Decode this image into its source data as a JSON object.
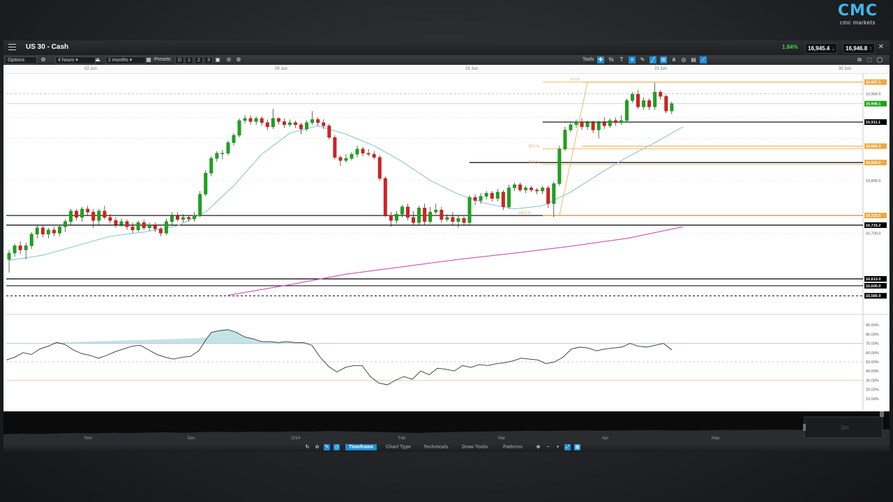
{
  "brand": {
    "mark": "CMC",
    "name": "cmc markets"
  },
  "titlebar": {
    "instrument": "US 30 - Cash",
    "change": "1.84%",
    "sell_price": "16,945.4",
    "buy_price": "16,946.8",
    "close_glyph": "✕"
  },
  "toolbar": {
    "options": "Options",
    "interval": "4 hours",
    "range": "2 months",
    "presets": "Presets",
    "preset_buttons": [
      "D",
      "1",
      "2",
      "3"
    ],
    "tools": "Tools"
  },
  "date_axis": {
    "labels": [
      "02 Jun",
      "09 Jun",
      "16 Jun",
      "23 Jun",
      "30 Jun"
    ]
  },
  "price_labels": [
    "16,987.1",
    "16,964.9",
    "16,946.1",
    "16,911.1",
    "16,865.3",
    "16,834.2",
    "16,800.0",
    "16,733.5",
    "16,715.2",
    "16,700.0",
    "16,613.0",
    "16,600.0",
    "16,580.9"
  ],
  "fib_labels": [
    "0.0 %",
    "50.0 %",
    "61.8 %",
    "100.0 %"
  ],
  "rsi_labels": [
    "90.00%",
    "80.00%",
    "70.00%",
    "60.00%",
    "50.00%",
    "40.00%",
    "30.00%",
    "20.00%",
    "10.00%"
  ],
  "navigator": {
    "months": [
      "Nov",
      "Dec",
      "2014",
      "Feb",
      "Mar",
      "Apr",
      "May"
    ],
    "window_label": "2m"
  },
  "bottom_tabs": [
    "Timeframe",
    "Chart Type",
    "Technicals",
    "Draw Tools",
    "Patterns"
  ],
  "colors": {
    "up": "#1aa51a",
    "down": "#d62020",
    "accent": "#1d8ed6",
    "sma_short": "#8cc6d8",
    "sma_long": "#d04fb0",
    "fib": "#f0a840",
    "last_price_bg": "#1aa51a"
  },
  "chart_data": {
    "type": "candlestick",
    "ylim": [
      16560,
      17000
    ],
    "candles": [
      [
        16650,
        16662,
        16625,
        16668
      ],
      [
        16662,
        16676,
        16655,
        16680
      ],
      [
        16676,
        16668,
        16660,
        16684
      ],
      [
        16668,
        16676,
        16650,
        16682
      ],
      [
        16676,
        16698,
        16670,
        16702
      ],
      [
        16698,
        16710,
        16690,
        16716
      ],
      [
        16710,
        16698,
        16692,
        16714
      ],
      [
        16698,
        16706,
        16690,
        16710
      ],
      [
        16706,
        16700,
        16694,
        16712
      ],
      [
        16700,
        16712,
        16694,
        16716
      ],
      [
        16712,
        16722,
        16702,
        16726
      ],
      [
        16722,
        16742,
        16716,
        16746
      ],
      [
        16742,
        16730,
        16724,
        16746
      ],
      [
        16730,
        16746,
        16722,
        16750
      ],
      [
        16746,
        16740,
        16734,
        16752
      ],
      [
        16740,
        16724,
        16710,
        16746
      ],
      [
        16724,
        16742,
        16716,
        16746
      ],
      [
        16742,
        16730,
        16726,
        16752
      ],
      [
        16730,
        16724,
        16718,
        16736
      ],
      [
        16724,
        16716,
        16710,
        16730
      ],
      [
        16716,
        16722,
        16712,
        16728
      ],
      [
        16722,
        16712,
        16706,
        16726
      ],
      [
        16712,
        16706,
        16700,
        16720
      ],
      [
        16706,
        16720,
        16702,
        16724
      ],
      [
        16720,
        16710,
        16706,
        16726
      ],
      [
        16710,
        16716,
        16704,
        16720
      ],
      [
        16716,
        16708,
        16702,
        16720
      ],
      [
        16708,
        16700,
        16694,
        16712
      ],
      [
        16700,
        16722,
        16696,
        16728
      ],
      [
        16722,
        16733,
        16716,
        16740
      ],
      [
        16733,
        16726,
        16722,
        16740
      ],
      [
        16726,
        16730,
        16720,
        16736
      ],
      [
        16730,
        16727,
        16722,
        16734
      ],
      [
        16727,
        16734,
        16722,
        16740
      ],
      [
        16734,
        16774,
        16730,
        16780
      ],
      [
        16774,
        16814,
        16770,
        16820
      ],
      [
        16814,
        16842,
        16808,
        16846
      ],
      [
        16842,
        16852,
        16836,
        16856
      ],
      [
        16852,
        16852,
        16840,
        16858
      ],
      [
        16852,
        16872,
        16848,
        16876
      ],
      [
        16872,
        16886,
        16866,
        16890
      ],
      [
        16886,
        16914,
        16882,
        16918
      ],
      [
        16914,
        16918,
        16908,
        16924
      ],
      [
        16918,
        16912,
        16906,
        16924
      ],
      [
        16912,
        16918,
        16906,
        16922
      ],
      [
        16918,
        16910,
        16904,
        16922
      ],
      [
        16910,
        16902,
        16896,
        16916
      ],
      [
        16902,
        16918,
        16898,
        16936
      ],
      [
        16918,
        16912,
        16906,
        16920
      ],
      [
        16912,
        16906,
        16900,
        16918
      ],
      [
        16906,
        16910,
        16902,
        16916
      ],
      [
        16910,
        16906,
        16900,
        16914
      ],
      [
        16906,
        16898,
        16888,
        16910
      ],
      [
        16898,
        16910,
        16894,
        16914
      ],
      [
        16910,
        16916,
        16906,
        16932
      ],
      [
        16916,
        16910,
        16904,
        16920
      ],
      [
        16910,
        16904,
        16898,
        16916
      ],
      [
        16904,
        16882,
        16878,
        16908
      ],
      [
        16882,
        16844,
        16840,
        16886
      ],
      [
        16844,
        16838,
        16828,
        16848
      ],
      [
        16838,
        16842,
        16834,
        16850
      ],
      [
        16842,
        16850,
        16838,
        16854
      ],
      [
        16850,
        16860,
        16844,
        16866
      ],
      [
        16860,
        16852,
        16846,
        16864
      ],
      [
        16852,
        16850,
        16846,
        16860
      ],
      [
        16850,
        16844,
        16840,
        16856
      ],
      [
        16844,
        16804,
        16800,
        16848
      ],
      [
        16804,
        16734,
        16730,
        16808
      ],
      [
        16734,
        16724,
        16712,
        16740
      ],
      [
        16724,
        16736,
        16718,
        16742
      ],
      [
        16736,
        16750,
        16730,
        16754
      ],
      [
        16750,
        16730,
        16724,
        16756
      ],
      [
        16730,
        16720,
        16716,
        16742
      ],
      [
        16720,
        16748,
        16716,
        16752
      ],
      [
        16748,
        16722,
        16716,
        16756
      ],
      [
        16722,
        16740,
        16718,
        16750
      ],
      [
        16740,
        16744,
        16736,
        16756
      ],
      [
        16744,
        16726,
        16720,
        16750
      ],
      [
        16726,
        16730,
        16722,
        16736
      ],
      [
        16730,
        16722,
        16716,
        16740
      ],
      [
        16722,
        16728,
        16710,
        16734
      ],
      [
        16728,
        16720,
        16714,
        16732
      ],
      [
        16720,
        16768,
        16716,
        16772
      ],
      [
        16768,
        16762,
        16754,
        16774
      ],
      [
        16762,
        16770,
        16756,
        16776
      ],
      [
        16770,
        16776,
        16764,
        16780
      ],
      [
        16776,
        16766,
        16760,
        16780
      ],
      [
        16766,
        16778,
        16760,
        16784
      ],
      [
        16778,
        16750,
        16744,
        16782
      ],
      [
        16750,
        16786,
        16746,
        16792
      ],
      [
        16786,
        16792,
        16780,
        16796
      ],
      [
        16792,
        16782,
        16778,
        16796
      ],
      [
        16782,
        16786,
        16776,
        16790
      ],
      [
        16786,
        16782,
        16778,
        16790
      ],
      [
        16782,
        16780,
        16774,
        16786
      ],
      [
        16780,
        16786,
        16774,
        16790
      ],
      [
        16786,
        16756,
        16748,
        16790
      ],
      [
        16756,
        16794,
        16730,
        16798
      ],
      [
        16794,
        16860,
        16790,
        16866
      ],
      [
        16860,
        16896,
        16856,
        16902
      ],
      [
        16896,
        16906,
        16892,
        16910
      ],
      [
        16906,
        16912,
        16900,
        16916
      ],
      [
        16912,
        16902,
        16896,
        16918
      ],
      [
        16902,
        16910,
        16896,
        16914
      ],
      [
        16910,
        16896,
        16890,
        16914
      ],
      [
        16896,
        16910,
        16880,
        16914
      ],
      [
        16910,
        16904,
        16898,
        16920
      ],
      [
        16904,
        16914,
        16900,
        16918
      ],
      [
        16914,
        16910,
        16904,
        16920
      ],
      [
        16910,
        16914,
        16906,
        16924
      ],
      [
        16914,
        16952,
        16910,
        16956
      ],
      [
        16952,
        16964,
        16948,
        16968
      ],
      [
        16964,
        16940,
        16936,
        16972
      ],
      [
        16940,
        16952,
        16934,
        16958
      ],
      [
        16952,
        16940,
        16934,
        16956
      ],
      [
        16940,
        16968,
        16934,
        16986
      ],
      [
        16968,
        16960,
        16954,
        16972
      ],
      [
        16960,
        16932,
        16928,
        16964
      ],
      [
        16932,
        16946,
        16926,
        16950
      ]
    ],
    "sma_short": [
      [
        0,
        16648
      ],
      [
        6,
        16658
      ],
      [
        12,
        16676
      ],
      [
        18,
        16694
      ],
      [
        24,
        16702
      ],
      [
        30,
        16714
      ],
      [
        35,
        16740
      ],
      [
        40,
        16790
      ],
      [
        45,
        16850
      ],
      [
        50,
        16890
      ],
      [
        55,
        16904
      ],
      [
        60,
        16888
      ],
      [
        65,
        16866
      ],
      [
        70,
        16836
      ],
      [
        75,
        16800
      ],
      [
        80,
        16774
      ],
      [
        85,
        16756
      ],
      [
        90,
        16746
      ],
      [
        95,
        16752
      ],
      [
        100,
        16778
      ],
      [
        105,
        16812
      ],
      [
        110,
        16844
      ],
      [
        115,
        16872
      ],
      [
        120,
        16902
      ]
    ],
    "sma_long": [
      [
        39,
        16582
      ],
      [
        50,
        16602
      ],
      [
        60,
        16622
      ],
      [
        70,
        16636
      ],
      [
        80,
        16650
      ],
      [
        90,
        16662
      ],
      [
        100,
        16675
      ],
      [
        110,
        16690
      ],
      [
        120,
        16712
      ]
    ],
    "horizontal_levels": [
      16987.1,
      16964.9,
      16946.1,
      16911.1,
      16865.3,
      16834.2,
      16733.5,
      16715.2,
      16613.0,
      16600.0,
      16580.9
    ],
    "fibonacci": {
      "high": 16987.1,
      "low": 16733.5,
      "levels": [
        "0.0 %",
        "50.0 %",
        "61.8 %",
        "100.0 %"
      ]
    },
    "rsi": {
      "ylim": [
        0,
        100
      ],
      "overbought": 70,
      "oversold": 30,
      "values": [
        [
          0,
          52
        ],
        [
          4,
          55
        ],
        [
          8,
          60
        ],
        [
          12,
          58
        ],
        [
          16,
          64
        ],
        [
          20,
          67
        ],
        [
          24,
          71
        ],
        [
          28,
          69
        ],
        [
          32,
          63
        ],
        [
          36,
          59
        ],
        [
          40,
          57
        ],
        [
          44,
          54
        ],
        [
          48,
          57
        ],
        [
          52,
          61
        ],
        [
          56,
          64
        ],
        [
          60,
          67
        ],
        [
          64,
          68
        ],
        [
          68,
          63
        ],
        [
          72,
          58
        ],
        [
          76,
          55
        ],
        [
          80,
          53
        ],
        [
          84,
          55
        ],
        [
          88,
          56
        ],
        [
          92,
          62
        ],
        [
          96,
          76
        ],
        [
          98,
          82
        ],
        [
          102,
          84
        ],
        [
          106,
          85
        ],
        [
          110,
          82
        ],
        [
          114,
          77
        ],
        [
          118,
          75
        ],
        [
          122,
          72
        ],
        [
          126,
          72
        ],
        [
          130,
          71
        ],
        [
          134,
          72
        ],
        [
          138,
          71
        ],
        [
          142,
          71
        ],
        [
          146,
          68
        ],
        [
          150,
          55
        ],
        [
          154,
          45
        ],
        [
          158,
          39
        ],
        [
          162,
          44
        ],
        [
          166,
          46
        ],
        [
          170,
          46
        ],
        [
          174,
          34
        ],
        [
          178,
          27
        ],
        [
          182,
          25
        ],
        [
          186,
          30
        ],
        [
          190,
          34
        ],
        [
          194,
          31
        ],
        [
          198,
          40
        ],
        [
          202,
          36
        ],
        [
          206,
          43
        ],
        [
          210,
          42
        ],
        [
          214,
          40
        ],
        [
          218,
          46
        ],
        [
          222,
          44
        ],
        [
          226,
          47
        ],
        [
          230,
          46
        ],
        [
          234,
          48
        ],
        [
          238,
          49
        ],
        [
          242,
          51
        ],
        [
          246,
          54
        ],
        [
          250,
          53
        ],
        [
          254,
          52
        ],
        [
          258,
          48
        ],
        [
          262,
          50
        ],
        [
          266,
          55
        ],
        [
          270,
          64
        ],
        [
          274,
          66
        ],
        [
          278,
          65
        ],
        [
          282,
          62
        ],
        [
          286,
          64
        ],
        [
          290,
          65
        ],
        [
          294,
          66
        ],
        [
          298,
          70
        ],
        [
          302,
          67
        ],
        [
          306,
          66
        ],
        [
          310,
          68
        ],
        [
          314,
          70
        ],
        [
          318,
          63
        ]
      ]
    },
    "navigator_series": [
      0.35,
      0.42,
      0.38,
      0.45,
      0.5,
      0.46,
      0.52,
      0.48,
      0.55,
      0.58,
      0.52,
      0.6,
      0.64,
      0.6,
      0.66,
      0.62,
      0.7,
      0.68,
      0.74,
      0.7,
      0.65,
      0.6,
      0.55,
      0.5,
      0.58,
      0.62,
      0.66,
      0.7,
      0.72,
      0.76,
      0.74,
      0.78,
      0.8,
      0.77,
      0.8,
      0.82,
      0.84,
      0.8,
      0.78,
      0.82,
      0.86,
      0.84,
      0.88,
      0.9,
      0.86,
      0.88,
      0.9,
      0.92,
      0.9,
      0.93
    ]
  }
}
